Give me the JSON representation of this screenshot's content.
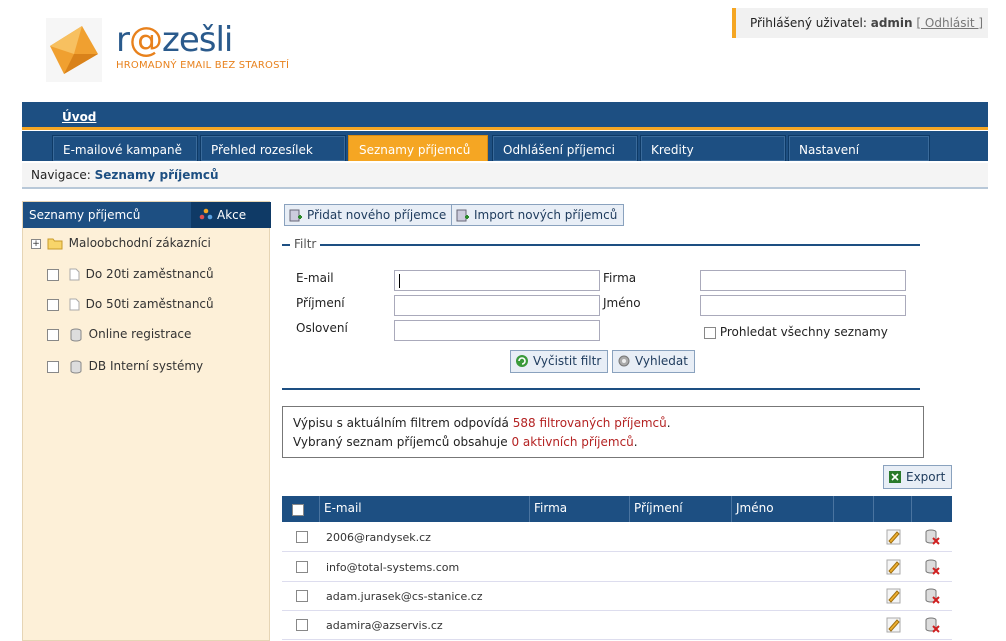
{
  "header": {
    "logo_pre": "r",
    "logo_at": "@",
    "logo_post": "zešli",
    "tagline": "HROMADNÝ EMAIL BEZ STAROSTÍ",
    "user_label": "Přihlášený uživatel:",
    "user_name": "admin",
    "logout": "[ Odhlásit ]"
  },
  "topnav": {
    "home": "Úvod"
  },
  "tabs": [
    {
      "label": "E-mailové kampaně"
    },
    {
      "label": "Přehled rozesílek"
    },
    {
      "label": "Seznamy příjemců",
      "active": true
    },
    {
      "label": "Odhlášení příjemci"
    },
    {
      "label": "Kredity"
    },
    {
      "label": "Nastavení"
    }
  ],
  "breadcrumb": {
    "label": "Navigace:",
    "current": "Seznamy příjemců"
  },
  "sidebar": {
    "title": "Seznamy příjemců",
    "actions": "Akce",
    "items": [
      {
        "label": "Maloobchodní zákazníci"
      },
      {
        "label": "Do 20ti zaměstnanců"
      },
      {
        "label": "Do 50ti zaměstnanců"
      },
      {
        "label": "Online registrace"
      },
      {
        "label": "DB Interní systémy"
      }
    ]
  },
  "toolbar": {
    "add_recipient": "Přidat nového příjemce",
    "import_recipients": "Import nových příjemců"
  },
  "filter": {
    "legend": "Filtr",
    "email_label": "E-mail",
    "surname_label": "Příjmení",
    "salutation_label": "Oslovení",
    "company_label": "Firma",
    "firstname_label": "Jméno",
    "search_all_label": "Prohledat všechny seznamy",
    "clear_button": "Vyčistit filtr",
    "search_button": "Vyhledat"
  },
  "info": {
    "line1_pre": "Výpisu s aktuálním filtrem odpovídá ",
    "line1_red": "588 filtrovaných příjemců",
    "line1_post": ".",
    "line2_pre": "Vybraný seznam příjemců obsahuje ",
    "line2_red": "0 aktivních příjemců",
    "line2_post": "."
  },
  "export_label": "Export",
  "table": {
    "headers": [
      "E-mail",
      "Firma",
      "Příjmení",
      "Jméno"
    ],
    "rows": [
      {
        "email": "2006@randysek.cz"
      },
      {
        "email": "info@total-systems.com"
      },
      {
        "email": "adam.jurasek@cs-stanice.cz"
      },
      {
        "email": "adamira@azservis.cz"
      }
    ]
  },
  "colors": {
    "navy": "#1d4f82",
    "orange": "#f5a623",
    "sidebar_bg": "#fdf0d8",
    "highlight_red": "#b42323"
  }
}
